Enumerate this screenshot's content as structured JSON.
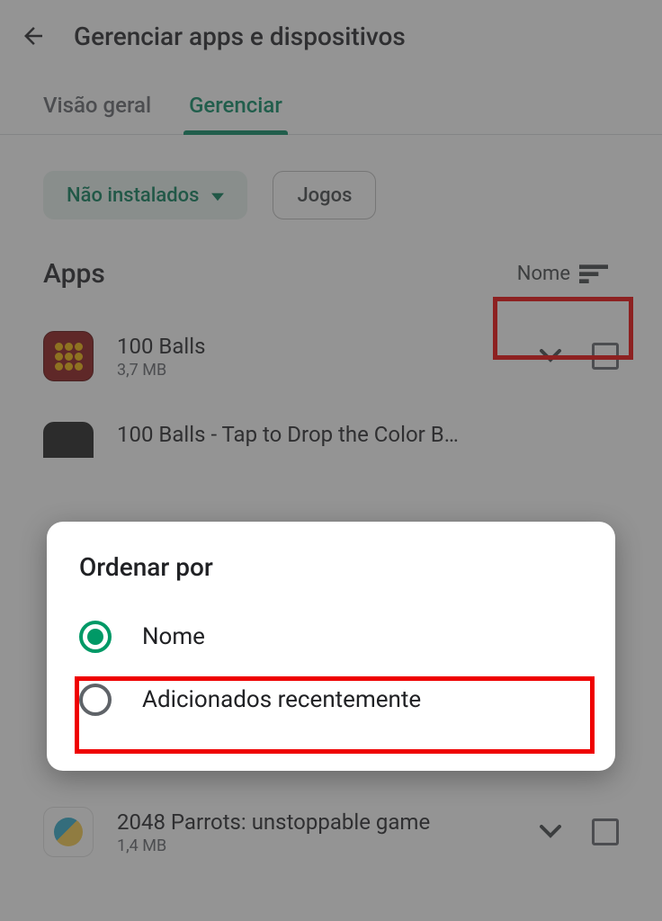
{
  "header": {
    "title": "Gerenciar apps e dispositivos"
  },
  "tabs": {
    "overview": "Visão geral",
    "manage": "Gerenciar"
  },
  "chips": {
    "not_installed": "Não instalados",
    "games": "Jogos"
  },
  "section": {
    "title": "Apps",
    "sort_label": "Nome"
  },
  "apps": [
    {
      "name": "100 Balls",
      "size": "3,7 MB"
    },
    {
      "name": "100 Balls - Tap to Drop the Color B...",
      "size": ""
    },
    {
      "name": "2048 Parrots: unstoppable game",
      "size": "1,4 MB"
    }
  ],
  "dialog": {
    "title": "Ordenar por",
    "options": [
      {
        "label": "Nome",
        "selected": true
      },
      {
        "label": "Adicionados recentemente",
        "selected": false
      }
    ]
  },
  "colors": {
    "accent": "#00875f",
    "highlight": "#ef0000"
  }
}
